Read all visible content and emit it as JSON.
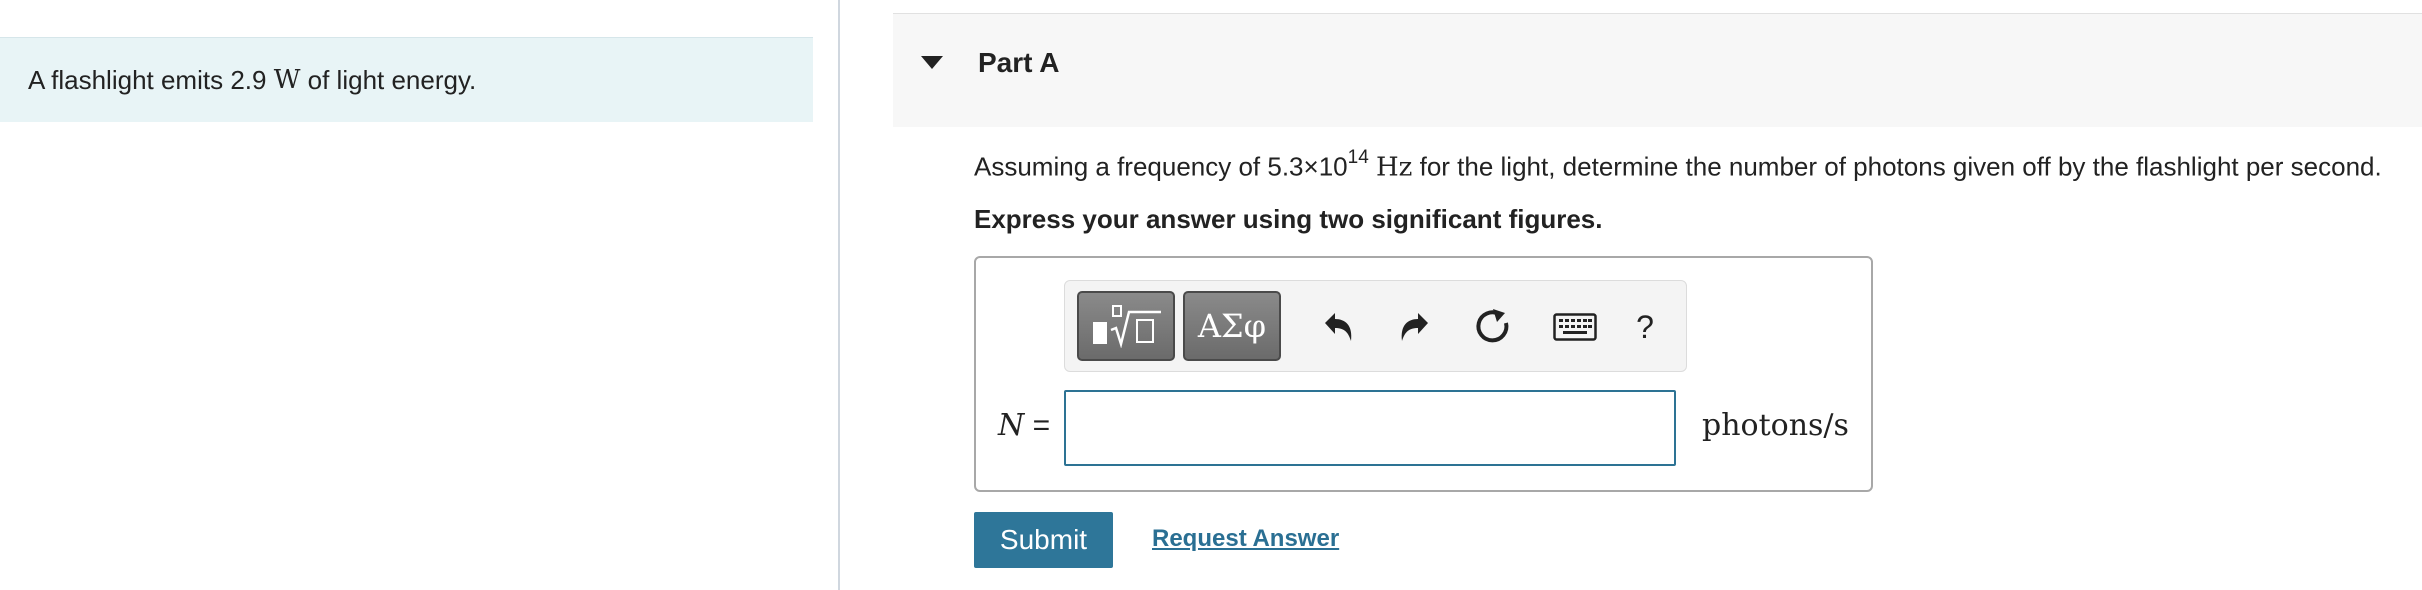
{
  "problem": {
    "prefix": "A flashlight emits 2.9 ",
    "unit": "W",
    "suffix": " of light energy."
  },
  "part": {
    "title": "Part A"
  },
  "question": {
    "prefix": "Assuming a frequency of 5.3×10",
    "exponent": "14",
    "unit": "Hz",
    "suffix": " for the light, determine the number of photons given off by the flashlight per second."
  },
  "instruction": "Express your answer using two significant figures.",
  "toolbar": {
    "templates_icon": "templates-sqrt-icon",
    "symbols_label": "ΑΣφ",
    "undo_icon": "undo-icon",
    "redo_icon": "redo-icon",
    "reset_icon": "reset-icon",
    "keyboard_icon": "keyboard-icon",
    "help_label": "?"
  },
  "answer": {
    "variable": "N",
    "equals": " =",
    "value": "",
    "units": "photons/s"
  },
  "actions": {
    "submit_label": "Submit",
    "request_label": "Request Answer"
  },
  "colors": {
    "accent": "#2e7699",
    "link": "#2a6f93",
    "problem_bg": "#e8f4f6"
  }
}
